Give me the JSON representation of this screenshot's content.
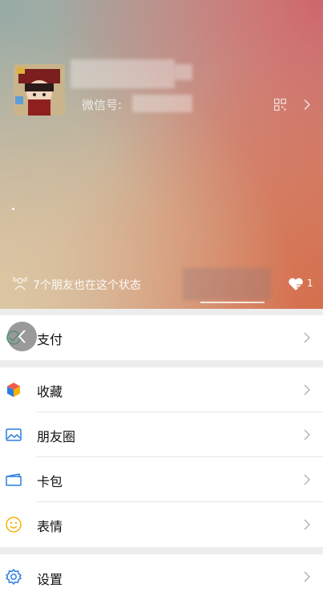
{
  "profile": {
    "wechat_id_label": "微信号:",
    "status_text": "7个朋友也在这个状态",
    "like_count": "1"
  },
  "menu": {
    "pay": "支付",
    "favorites": "收藏",
    "moments": "朋友圈",
    "cards": "卡包",
    "stickers": "表情",
    "settings": "设置"
  },
  "colors": {
    "accent_green": "#07c160",
    "icon_blue": "#2b7ce0",
    "icon_yellow": "#f5b300"
  }
}
